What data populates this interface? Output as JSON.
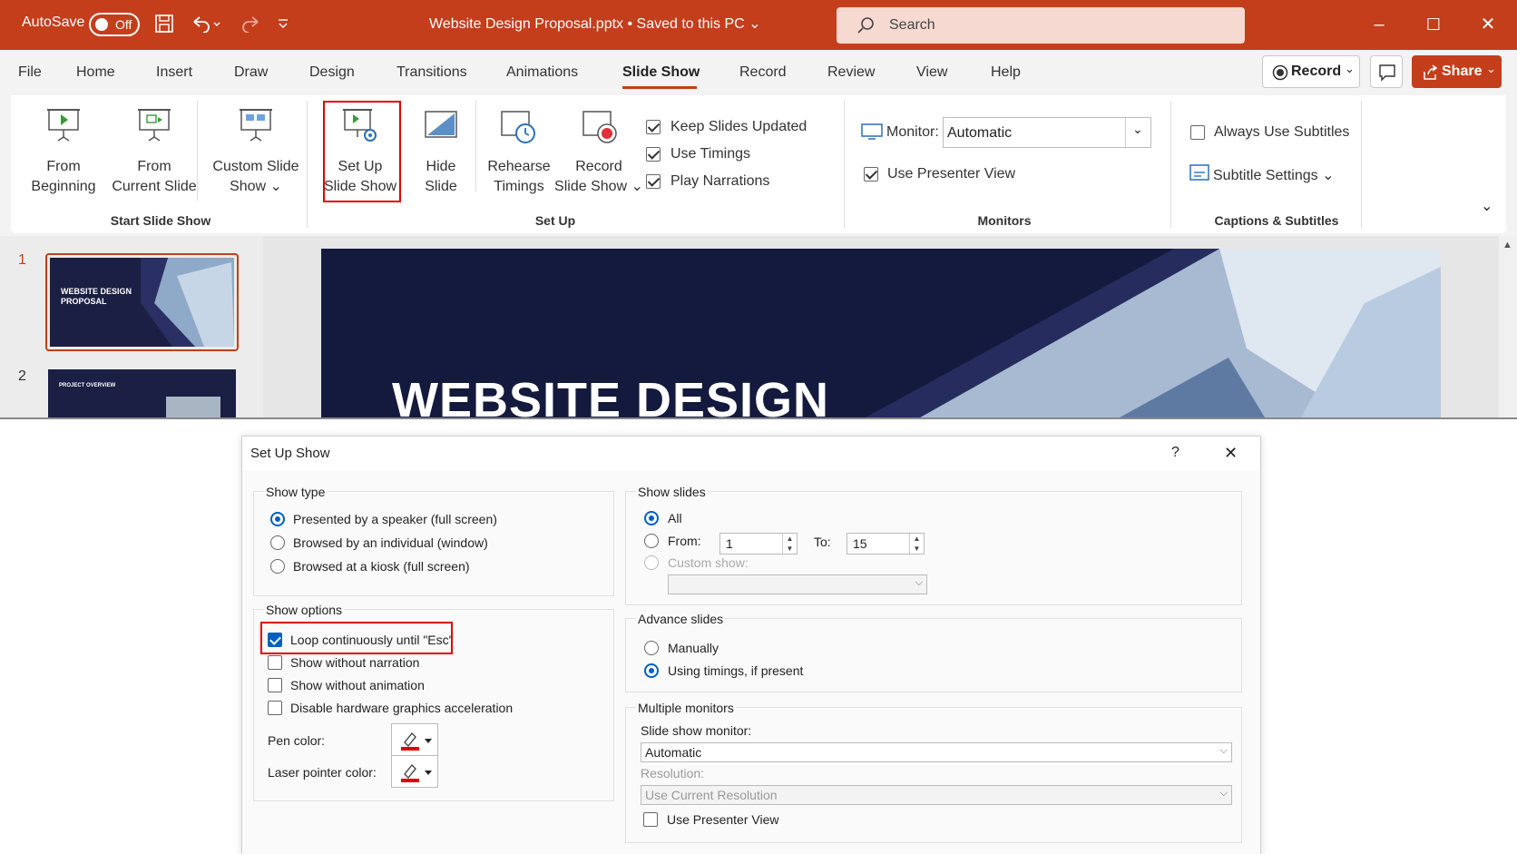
{
  "titlebar": {
    "autosave_label": "AutoSave",
    "autosave_state": "Off",
    "doc_title": "Website Design Proposal.pptx • Saved to this PC ⌄",
    "search_placeholder": "Search",
    "minimize": "–",
    "maximize": "☐",
    "close": "✕"
  },
  "tabs": [
    "File",
    "Home",
    "Insert",
    "Draw",
    "Design",
    "Transitions",
    "Animations",
    "Slide Show",
    "Record",
    "Review",
    "View",
    "Help"
  ],
  "active_tab": "Slide Show",
  "record_button": "Record",
  "share_button": "Share",
  "ribbon": {
    "from_beginning": [
      "From",
      "Beginning"
    ],
    "from_current": [
      "From",
      "Current Slide"
    ],
    "custom_show": [
      "Custom Slide",
      "Show ⌄"
    ],
    "group_start": "Start Slide Show",
    "setup_show": [
      "Set Up",
      "Slide Show"
    ],
    "hide_slide": [
      "Hide",
      "Slide"
    ],
    "rehearse": [
      "Rehearse",
      "Timings"
    ],
    "record_show": [
      "Record",
      "Slide Show ⌄"
    ],
    "keep_updated": "Keep Slides Updated",
    "use_timings": "Use Timings",
    "play_narrations": "Play Narrations",
    "group_setup": "Set Up",
    "monitor_label": "Monitor:",
    "monitor_value": "Automatic",
    "presenter_view": "Use Presenter View",
    "group_monitors": "Monitors",
    "always_subtitles": "Always Use Subtitles",
    "subtitle_settings": "Subtitle Settings ⌄",
    "group_captions": "Captions & Subtitles",
    "collapse": "⌄"
  },
  "slides": {
    "num1": "1",
    "num2": "2",
    "thumb1_title": "WEBSITE DESIGN PROPOSAL",
    "thumb2_title": "PROJECT OVERVIEW",
    "main_title": "WEBSITE DESIGN"
  },
  "dialog": {
    "title": "Set Up Show",
    "help": "?",
    "close": "✕",
    "show_type": "Show type",
    "type_speaker": "Presented by a speaker (full screen)",
    "type_individual": "Browsed by an individual (window)",
    "type_kiosk": "Browsed at a kiosk (full screen)",
    "show_options": "Show options",
    "opt_loop": "Loop continuously until \"Esc\"",
    "opt_no_narration": "Show without narration",
    "opt_no_animation": "Show without animation",
    "opt_disable_hw": "Disable hardware graphics acceleration",
    "pen_color": "Pen color:",
    "laser_color": "Laser pointer color:",
    "show_slides": "Show slides",
    "slides_all": "All",
    "slides_from": "From:",
    "from_value": "1",
    "to_label": "To:",
    "to_value": "15",
    "custom_show": "Custom show:",
    "advance_slides": "Advance slides",
    "adv_manual": "Manually",
    "adv_timings": "Using timings, if present",
    "multiple_monitors": "Multiple monitors",
    "monitor_label": "Slide show monitor:",
    "monitor_value": "Automatic",
    "resolution_label": "Resolution:",
    "resolution_value": "Use Current Resolution",
    "presenter_view": "Use Presenter View"
  },
  "colors": {
    "brand": "#c43e1c",
    "highlight": "#e00000",
    "accent": "#0060c0",
    "slide_bg": "#141a3d"
  }
}
